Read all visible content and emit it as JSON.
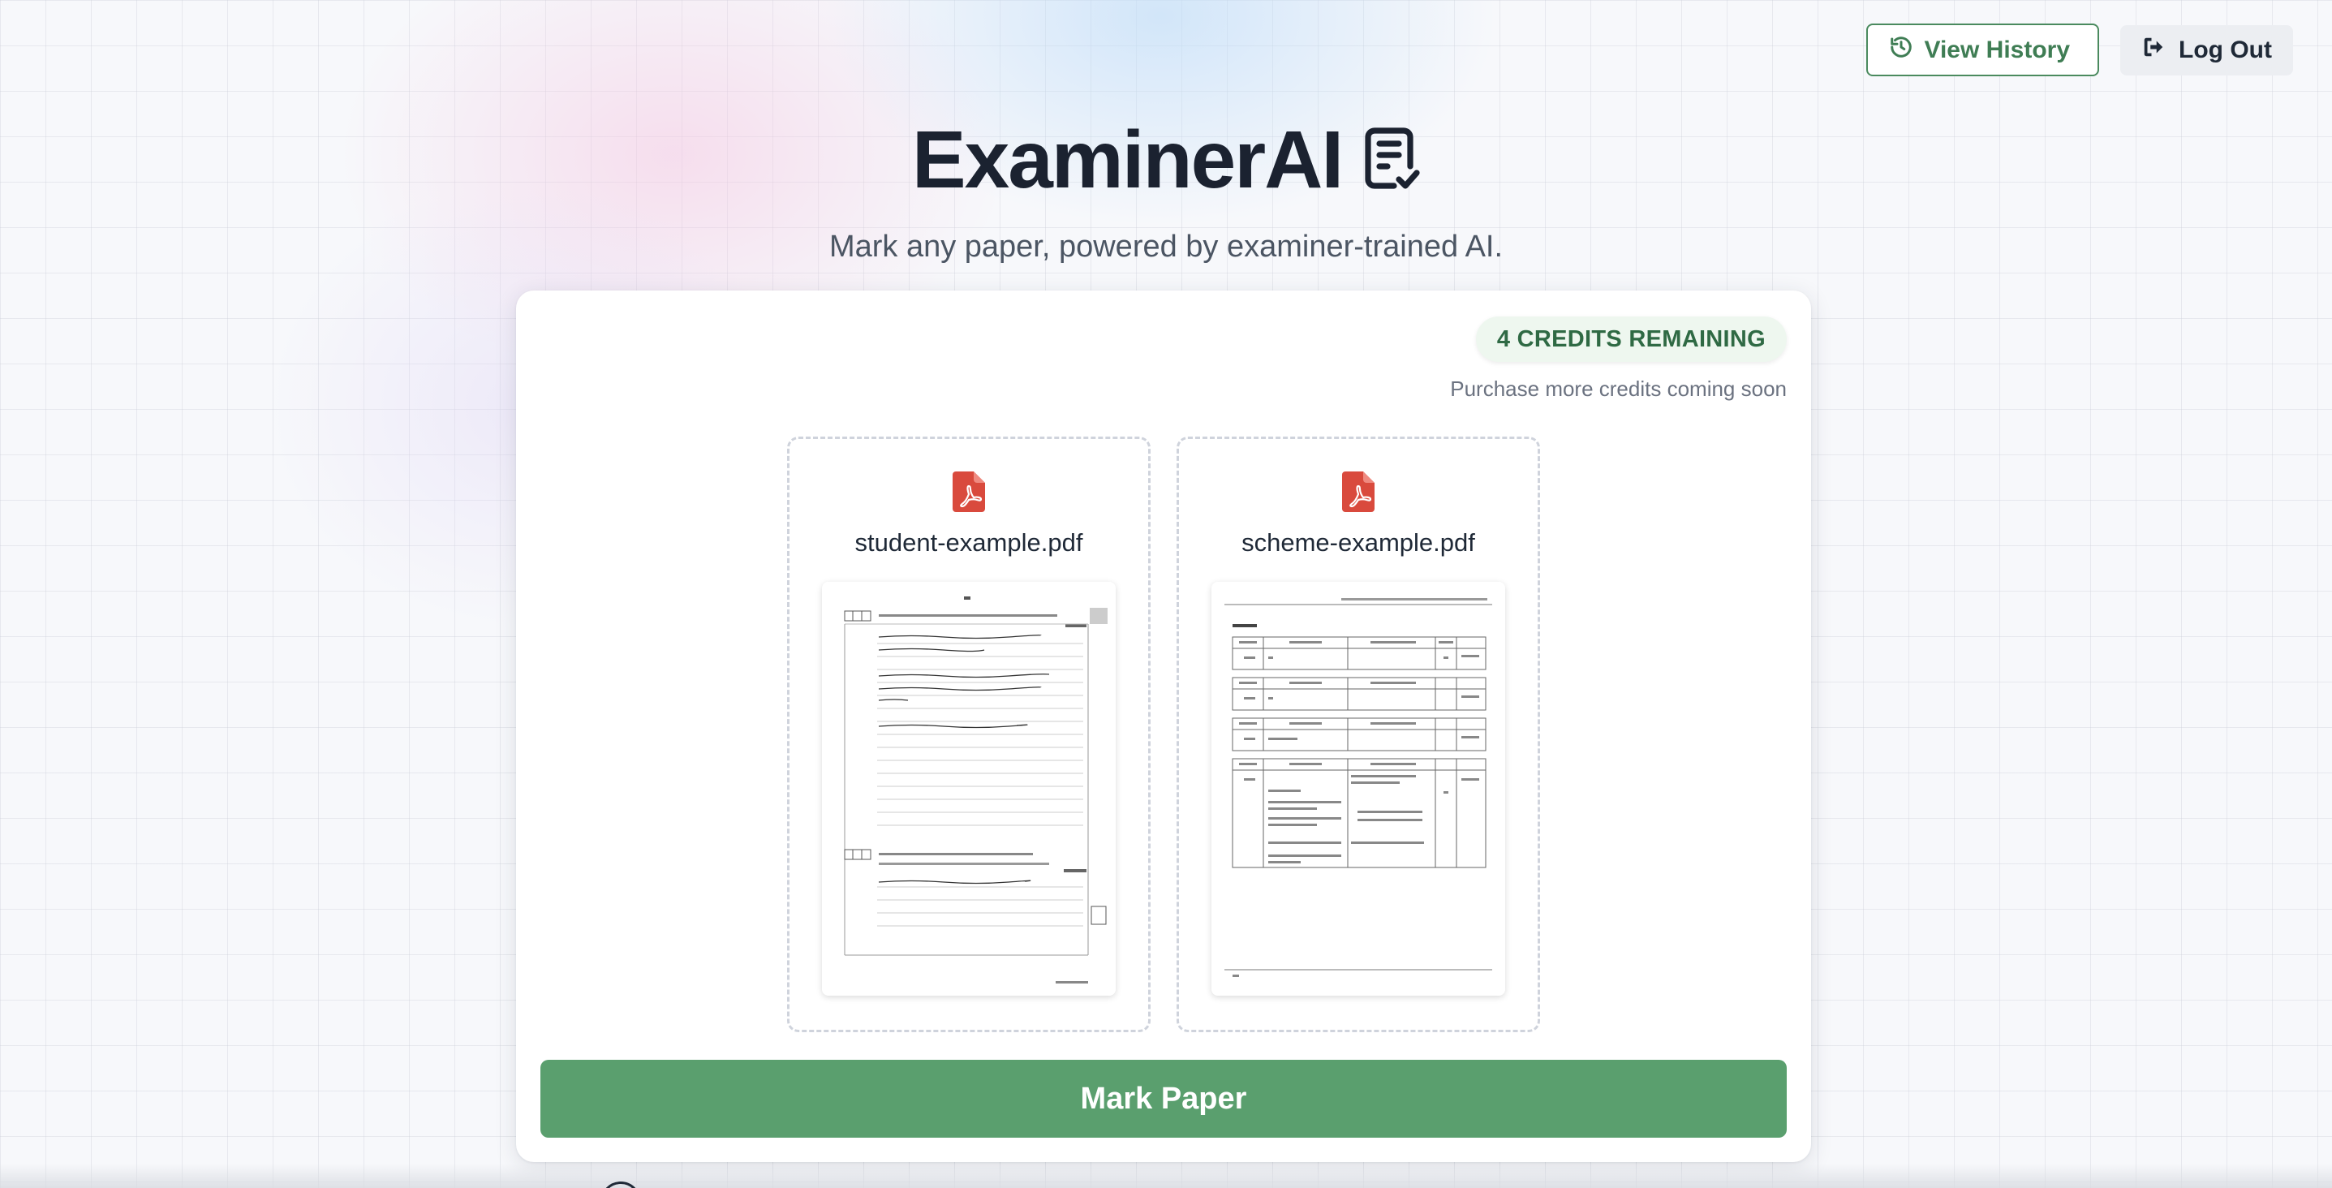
{
  "header": {
    "view_history_label": "View History",
    "logout_label": "Log Out"
  },
  "hero": {
    "title": "ExaminerAI",
    "subtitle": "Mark any paper, powered by examiner-trained AI."
  },
  "credits": {
    "badge": "4 CREDITS REMAINING",
    "note": "Purchase more credits coming soon"
  },
  "uploads": [
    {
      "filename": "student-example.pdf",
      "icon": "pdf-icon"
    },
    {
      "filename": "scheme-example.pdf",
      "icon": "pdf-icon"
    }
  ],
  "action": {
    "mark_label": "Mark Paper"
  },
  "colors": {
    "accent_green": "#5a9f6e",
    "pdf_red": "#d94a3d",
    "title_dark": "#1b2230"
  }
}
